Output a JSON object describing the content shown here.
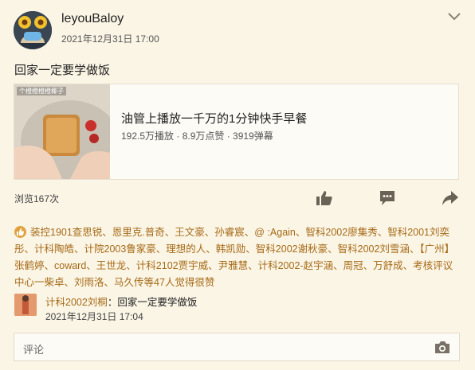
{
  "post": {
    "author": "leyouBaloy",
    "time": "2021年12月31日 17:00",
    "text": "回家一定要学做饭"
  },
  "video": {
    "badge": "个橙橙橙橙椰子",
    "title": "油管上播放一千万的1分钟快手早餐",
    "stats": "192.5万播放 · 8.9万点赞 · 3919弹幕"
  },
  "views_label": "浏览167次",
  "likes": {
    "names": "装控1901查思锐、恩里克.普奇、王文豪、孙睿宸、@ :Again、智科2002廖集秀、智科2001刘奕彤、计科陶皓、计院2003鲁家豪、理想的人、韩凯勋、智科2002谢秋豪、智科2002刘雪涵、【广州】张鹤婷、coward、王世龙、计科2102贾宇威、尹雅慧、计科2002-赵宇涵、周冠、万舒成、考核评议中心一柴卓、刘雨洛、马久传",
    "suffix": "等47人觉得很赞"
  },
  "comment": {
    "author": "计科2002刘桐",
    "separator": "：",
    "text": "回家一定要学做饭",
    "time": "2021年12月31日 17:04"
  },
  "comment_input": {
    "placeholder": "评论"
  },
  "colors": {
    "background": "#fbf5e6",
    "link": "#a66a16",
    "icon": "#6b6257"
  }
}
